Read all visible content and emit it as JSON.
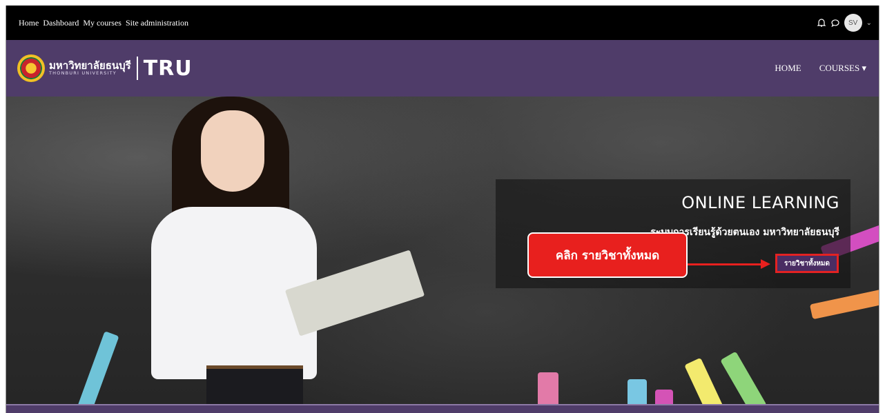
{
  "topbar": {
    "links": [
      "Home",
      "Dashboard",
      "My courses",
      "Site administration"
    ],
    "avatar_initials": "SV"
  },
  "header": {
    "logo_thai": "มหาวิทยาลัยธนบุรี",
    "logo_en": "THONBURI UNIVERSITY",
    "logo_abbr": "TRU",
    "nav_home": "HOME",
    "nav_courses": "COURSES ▾"
  },
  "hero": {
    "title": "ONLINE LEARNING",
    "subtitle": "ระบบการเรียนรู้ด้วยตนเอง มหาวิทยาลัยธนบุรี",
    "button_label": "รายวิชาทั้งหมด",
    "callout": "คลิก รายวิชาทั้งหมด"
  },
  "colors": {
    "topbar": "#000000",
    "header": "#4f3c69",
    "button": "#4a2d63",
    "highlight": "#e8201e"
  }
}
